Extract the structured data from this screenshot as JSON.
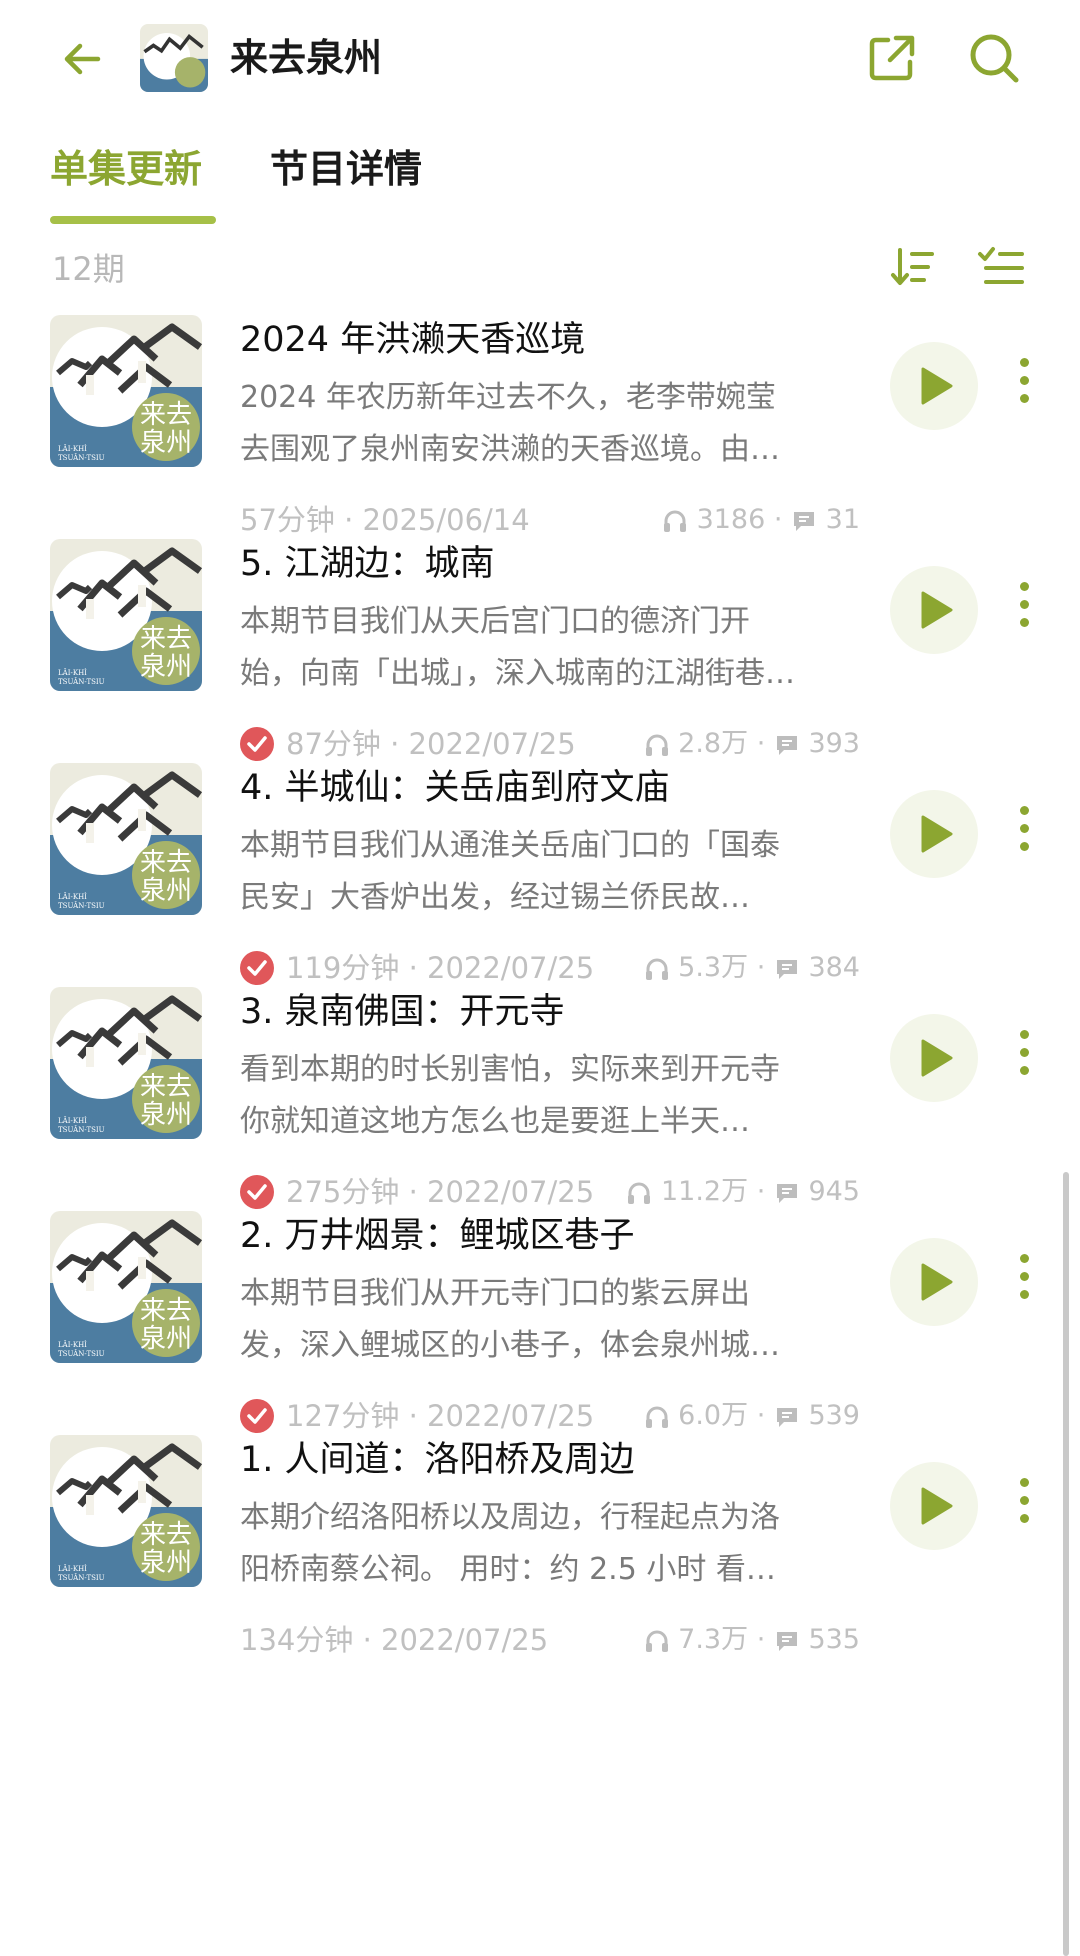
{
  "header": {
    "title": "来去泉州",
    "cover_text_1": "来去",
    "cover_text_2": "泉州"
  },
  "tabs": [
    {
      "label": "单集更新",
      "active": true
    },
    {
      "label": "节目详情",
      "active": false
    }
  ],
  "episode_count": "12期",
  "cover": {
    "line1": "来去",
    "line2": "泉州",
    "romanized1": "LÂI-KHÌ",
    "romanized2": "TSUÂN-TSIU"
  },
  "episodes": [
    {
      "title": "2024 年洪濑天香巡境",
      "desc1": "2024 年农历新年过去不久，老李带婉莹",
      "desc2": "去围观了泉州南安洪濑的天香巡境。由…",
      "duration_date": "57分钟 · 2025/06/14",
      "plays": "3186",
      "comments": "31",
      "played": false
    },
    {
      "title": "5. 江湖边：城南",
      "desc1": "本期节目我们从天后宫门口的德济门开",
      "desc2": "始，向南「出城」，深入城南的江湖街巷…",
      "duration_date": "87分钟 · 2022/07/25",
      "plays": "2.8万",
      "comments": "393",
      "played": true
    },
    {
      "title": "4. 半城仙：关岳庙到府文庙",
      "desc1": "本期节目我们从通淮关岳庙门口的「国泰",
      "desc2": "民安」大香炉出发，经过锡兰侨民故…",
      "duration_date": "119分钟 · 2022/07/25",
      "plays": "5.3万",
      "comments": "384",
      "played": true
    },
    {
      "title": "3. 泉南佛国：开元寺",
      "desc1": "看到本期的时长别害怕，实际来到开元寺",
      "desc2": "你就知道这地方怎么也是要逛上半天…",
      "duration_date": "275分钟 · 2022/07/25",
      "plays": "11.2万",
      "comments": "945",
      "played": true
    },
    {
      "title": "2. 万井烟景：鲤城区巷子",
      "desc1": "本期节目我们从开元寺门口的紫云屏出",
      "desc2": "发，深入鲤城区的小巷子，体会泉州城…",
      "duration_date": "127分钟 · 2022/07/25",
      "plays": "6.0万",
      "comments": "539",
      "played": true
    },
    {
      "title": "1. 人间道：洛阳桥及周边",
      "desc1": "本期介绍洛阳桥以及周边，行程起点为洛",
      "desc2": "阳桥南蔡公祠。 用时：约 2.5 小时 看…",
      "duration_date": "134分钟 · 2022/07/25",
      "plays": "7.3万",
      "comments": "535",
      "played": false
    }
  ],
  "colors": {
    "accent": "#8ca631",
    "accent_light": "#a6c048",
    "played_check": "#e0575a",
    "cover_blue": "#4d7da1",
    "cover_cream": "#ecebdf"
  }
}
